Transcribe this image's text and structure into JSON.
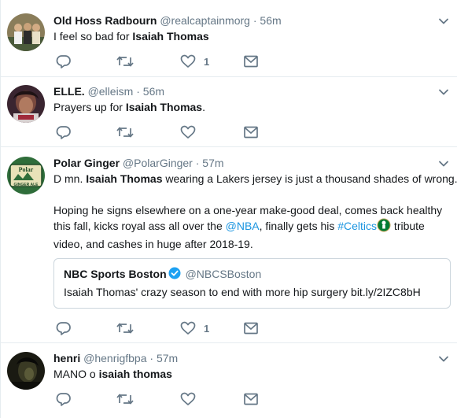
{
  "tweets": [
    {
      "name": "Old Hoss Radbourn",
      "handle": "@realcaptainmorg",
      "dot": "·",
      "time": "56m",
      "text_pre": "I feel so bad for ",
      "text_bold": "Isaiah Thomas",
      "like_count": "1"
    },
    {
      "name": "ELLE.",
      "handle": "@elleism",
      "dot": "·",
      "time": "56m",
      "text_pre": "Prayers up for ",
      "text_bold": "Isaiah Thomas",
      "text_post": "."
    },
    {
      "name": "Polar Ginger",
      "handle": "@PolarGinger",
      "dot": "·",
      "time": "57m",
      "line1_pre": "D  mn. ",
      "line1_bold": "Isaiah Thomas",
      "line1_post": " wearing a Lakers jersey is just a thousand shades of wrong.",
      "para2_a": "Hoping he signs elsewhere on a one-year make-good deal, comes back healthy this fall, kicks royal ass all over the ",
      "para2_link1": "@NBA",
      "para2_b": ", finally gets his ",
      "para2_link2": "#Celtics",
      "para2_c": " tribute video, and cashes in huge after 2018-19.",
      "avatar_text": "Polar GINGER ALE",
      "quote": {
        "name": "NBC Sports Boston",
        "handle": "@NBCSBoston",
        "text": "Isaiah Thomas' crazy season to end  with more hip surgery bit.ly/2IZC8bH"
      },
      "like_count": "1"
    },
    {
      "name": "henri",
      "handle": "@henrigfbpa",
      "dot": "·",
      "time": "57m",
      "text_pre": "MANO o ",
      "text_bold": "isaiah thomas"
    }
  ],
  "colors": {
    "text": "#14171a",
    "muted": "#657786",
    "link": "#1b95e0",
    "border": "#e6ecf0",
    "verified": "#1da1f2"
  },
  "icons": [
    "reply-icon",
    "retweet-icon",
    "like-icon",
    "message-icon",
    "chevron-down-icon",
    "verified-icon",
    "celtics-emoji-icon"
  ]
}
